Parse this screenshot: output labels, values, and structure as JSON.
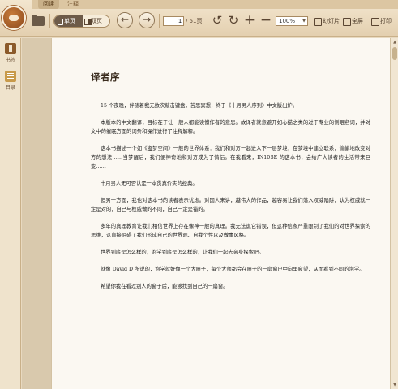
{
  "tabs": [
    {
      "label": "阅读"
    },
    {
      "label": "注释"
    }
  ],
  "toolbar": {
    "single_page_label": "单页",
    "double_page_label": "双页",
    "prev_icon": "arrow-left-icon",
    "next_icon": "arrow-right-icon",
    "current_page": "1",
    "total_pages": "/ 51页",
    "zoom_value": "100%",
    "slideshow_label": "幻灯片",
    "fullscreen_label": "全屏",
    "print_label": "打印"
  },
  "sidebar": {
    "items": [
      {
        "label": "书签",
        "icon": "bookmark-icon"
      },
      {
        "label": "目录",
        "icon": "toc-icon"
      }
    ]
  },
  "document": {
    "title": "译者序",
    "paragraphs": [
      "15 个夜晚，伴随着我无数次敲击键盘，苦思冥想，终于《十月男人序列》中文版出炉。",
      "本版本的中文翻译，目标在于让一般人都能读懂作者的意思。故译者就意避开如心描之类的过于专业的侧眠名词，并对文中的催眠方面的词条和操作进行了注释解释。",
      "这本书描述一个如《盗梦空间》一般的世界体系：我们和对方一起进入下一层梦境，在梦境中建立联系，偷偷地改变对方的想法……当梦醒后，我们便神奇地和对方成为了情侣。在我看来，IN10SE 的这本书，会给广大读者的生活带来巨变……",
      "十月男人无可否认是一本货真价实的经典。",
      "但另一方面，我也对这本书的读者表示忧虑。对国人来讲，越伟大的作品，越容易让我们落入权威陷阱，认为权威就一定是对的，自己与权威做的不同，自己一定是错的。",
      "多年的真理教育让我们相信世界上存在像神一般的真理。我无法说它错误，但这种信条严重限制了我们的对世界探索的思维，这直接阻碍了我们形成自己的世界观、自我个性以及做事风格。",
      "世界到底是怎么样的，泡学到底是怎么样的，让我们一起去亲身探索吧。",
      "就像 David D 所说的，泡学就好像一个大屋子，每个大师都会在屋子的一扇窗户中向里窥望，从而看到不同的泡学。",
      "希望你我在看过别人的窗子后，能够找到自己的一扇窗。"
    ]
  },
  "colors": {
    "toolbar_bg": "#e3cfaf",
    "page_bg": "#fbf8f2",
    "accent_brown": "#6e5b49"
  }
}
